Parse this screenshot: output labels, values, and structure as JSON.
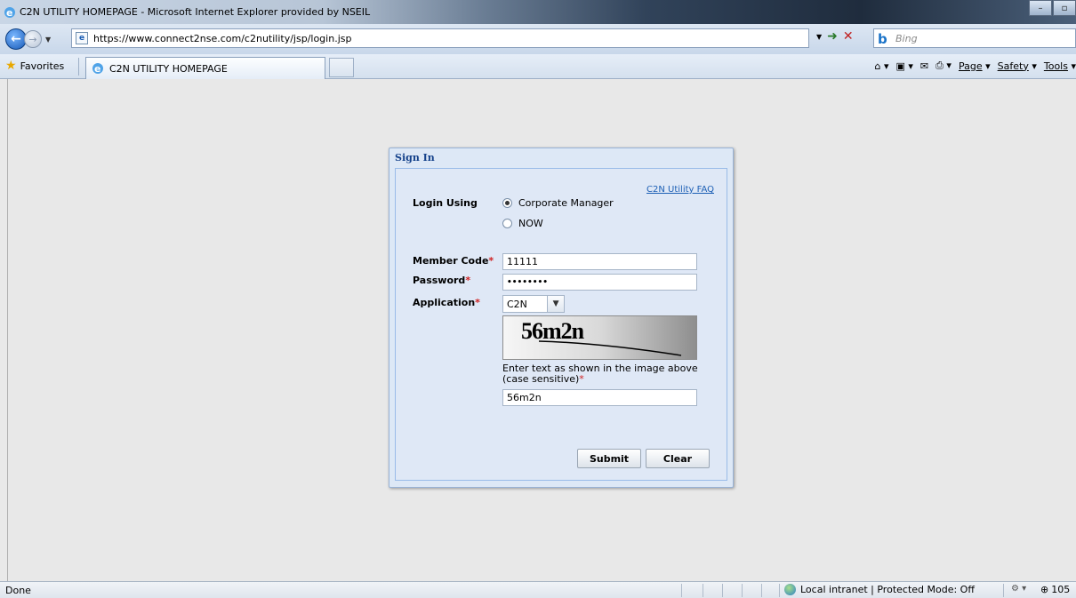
{
  "window": {
    "title": "C2N UTILITY HOMEPAGE - Microsoft Internet Explorer provided by NSEIL"
  },
  "address": {
    "url": "https://www.connect2nse.com/c2nutility/jsp/login.jsp",
    "search_placeholder": "Bing"
  },
  "favorites_bar": {
    "favorites_label": "Favorites",
    "tab_title": "C2N UTILITY HOMEPAGE",
    "commands": [
      "Page",
      "Safety",
      "Tools"
    ]
  },
  "signin": {
    "header": "Sign In",
    "faq_link": "C2N Utility FAQ",
    "login_using_label": "Login Using",
    "options": [
      "Corporate Manager",
      "NOW"
    ],
    "selected_option": "Corporate Manager",
    "member_code_label": "Member Code",
    "member_code_value": "11111",
    "password_label": "Password",
    "password_value": "••••••••",
    "application_label": "Application",
    "application_value": "C2N",
    "captcha_text": "56m2n",
    "captcha_hint_line1": "Enter text as shown in the image above",
    "captcha_hint_line2": "(case sensitive)",
    "captcha_input_value": "56m2n",
    "required_mark": "*",
    "submit_label": "Submit",
    "clear_label": "Clear"
  },
  "status": {
    "left": "Done",
    "zone": "Local intranet | Protected Mode: Off",
    "zoom": "105"
  }
}
